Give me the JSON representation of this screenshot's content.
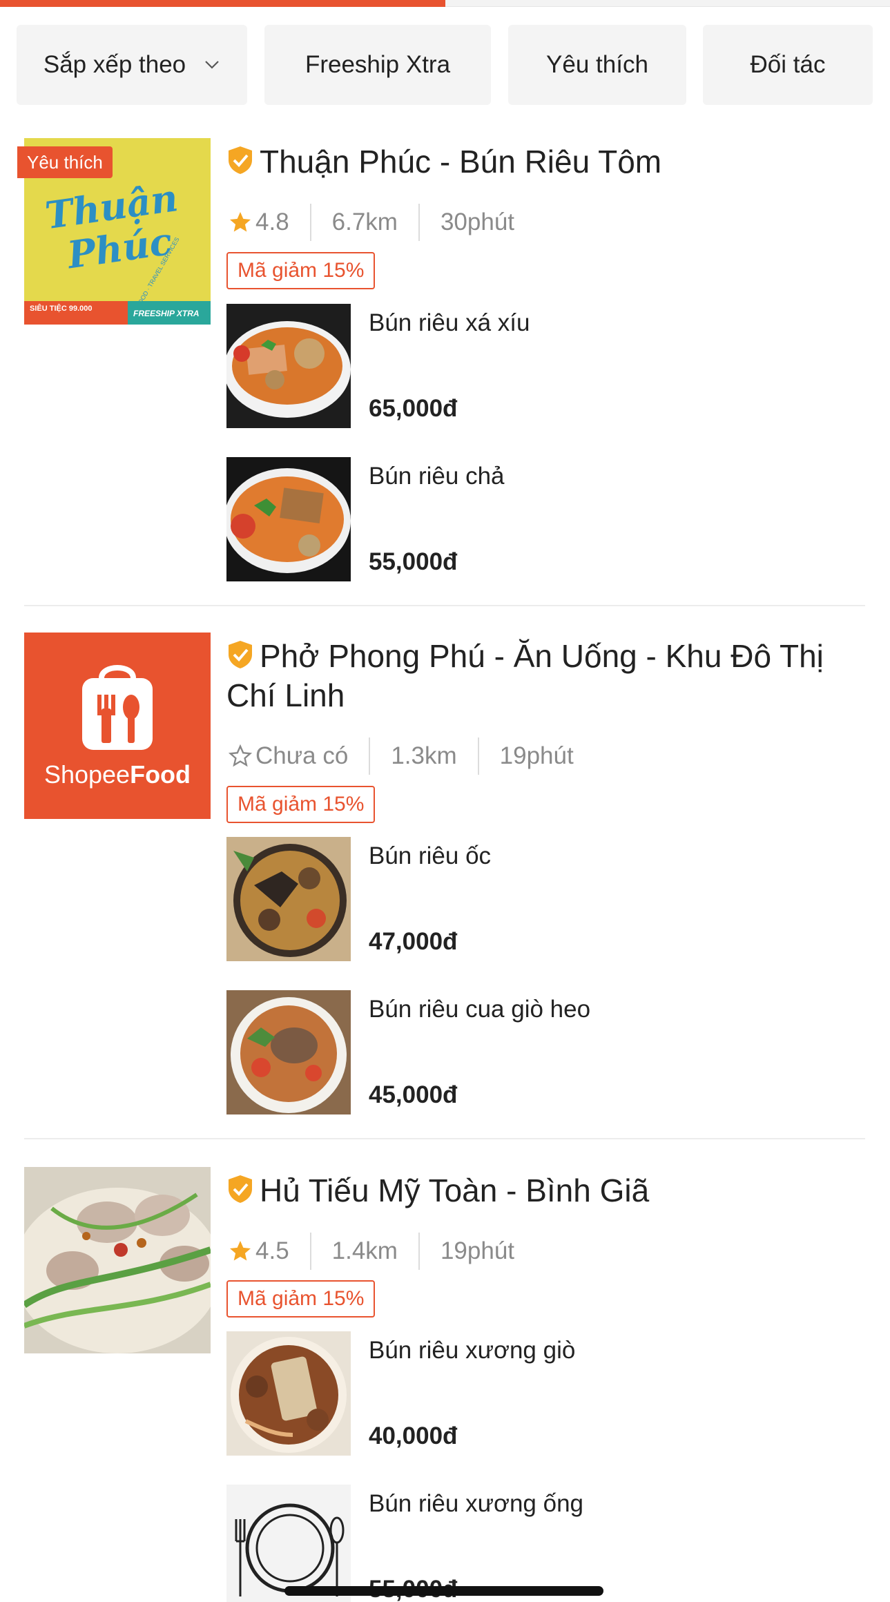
{
  "progress": {
    "fraction": 0.5
  },
  "filters": [
    {
      "label": "Sắp xếp theo",
      "has_dropdown": true
    },
    {
      "label": "Freeship Xtra"
    },
    {
      "label": "Yêu thích"
    },
    {
      "label": "Đối tác"
    }
  ],
  "colors": {
    "accent": "#e8532f",
    "star": "#f5a623",
    "verified": "#f5a623"
  },
  "shops": [
    {
      "name": "Thuận Phúc - Bún Riêu Tôm",
      "badge": "Yêu thích",
      "logo_text": "Thuận Phúc",
      "logo_sub": "FOOD · TRAVEL SERVICES",
      "logo_tag_left": "SIÊU TIỆC 99.000",
      "logo_tag_right": "FREESHIP XTRA",
      "rating": "4.8",
      "distance": "6.7km",
      "time": "30phút",
      "voucher": "Mã giảm 15%",
      "dishes": [
        {
          "name": "Bún riêu xá xíu",
          "price": "65,000đ"
        },
        {
          "name": "Bún riêu chả",
          "price": "55,000đ"
        }
      ]
    },
    {
      "name": "Phở Phong Phú - Ăn Uống - Khu Đô Thị Chí Linh",
      "logo_text_a": "Shopee",
      "logo_text_b": "Food",
      "rating": "Chưa có",
      "distance": "1.3km",
      "time": "19phút",
      "voucher": "Mã giảm 15%",
      "dishes": [
        {
          "name": "Bún riêu ốc",
          "price": "47,000đ"
        },
        {
          "name": "Bún riêu cua giò heo",
          "price": "45,000đ"
        }
      ]
    },
    {
      "name": "Hủ Tiếu Mỹ Toàn - Bình Giã",
      "rating": "4.5",
      "distance": "1.4km",
      "time": "19phút",
      "voucher": "Mã giảm 15%",
      "dishes": [
        {
          "name": "Bún riêu xương giò",
          "price": "40,000đ"
        },
        {
          "name": "Bún riêu xương ống",
          "price": "55,000đ"
        }
      ]
    }
  ]
}
